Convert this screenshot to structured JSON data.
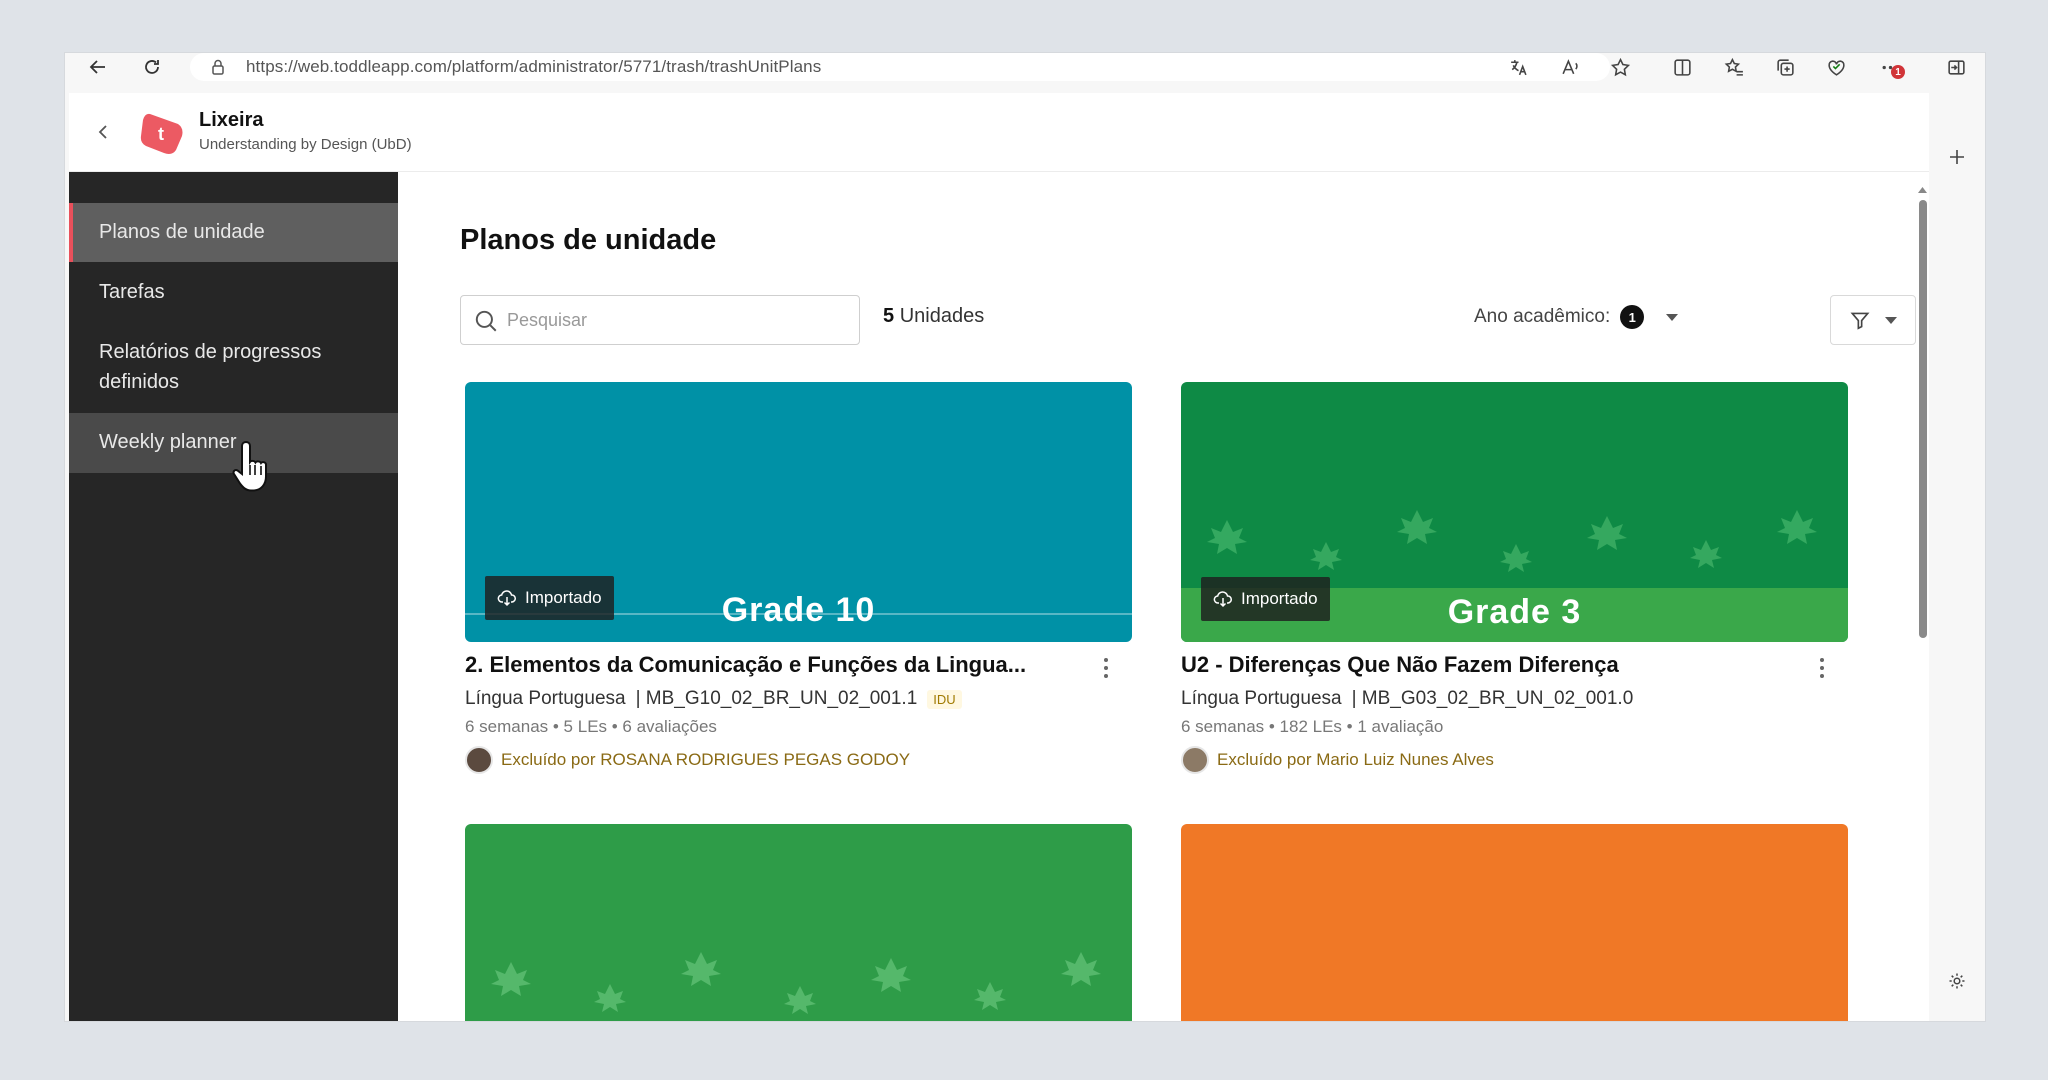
{
  "browser": {
    "url": "https://web.toddleapp.com/platform/administrator/5771/trash/trashUnitPlans",
    "notification_count": "1"
  },
  "app": {
    "title": "Lixeira",
    "subtitle": "Understanding by Design (UbD)",
    "logo_letter": "t",
    "accent_color": "#e8505b"
  },
  "sidebar": {
    "items": [
      {
        "label": "Planos de unidade"
      },
      {
        "label": "Tarefas"
      },
      {
        "label": "Relatórios de progressos definidos"
      },
      {
        "label": "Weekly planner"
      }
    ]
  },
  "main": {
    "heading": "Planos de unidade",
    "search_placeholder": "Pesquisar",
    "count_number": "5",
    "count_label": "Unidades",
    "academic_year_label": "Ano acadêmico:",
    "academic_year_count": "1"
  },
  "cards": [
    {
      "image_color": "#0091a6",
      "grade": "Grade 10",
      "import_label": "Importado",
      "title": "2. Elementos da Comunicação e Funções da Lingua...",
      "subject": "Língua Portuguesa",
      "code": "| MB_G10_02_BR_UN_02_001.1",
      "tag": "IDU",
      "meta": "6 semanas • 5 LEs • 6 avaliações",
      "deleted_by": "Excluído por ROSANA RODRIGUES PEGAS GODOY"
    },
    {
      "image_color": "#0e8a45",
      "grade": "Grade 3",
      "import_label": "Importado",
      "title": "U2 - Diferenças Que Não Fazem Diferença",
      "subject": "Língua Portuguesa",
      "code": "| MB_G03_02_BR_UN_02_001.0",
      "meta": "6 semanas • 182 LEs • 1 avaliação",
      "deleted_by": "Excluído por Mario Luiz Nunes Alves"
    },
    {
      "image_color": "#2e9c48"
    },
    {
      "image_color": "#f07826"
    }
  ]
}
